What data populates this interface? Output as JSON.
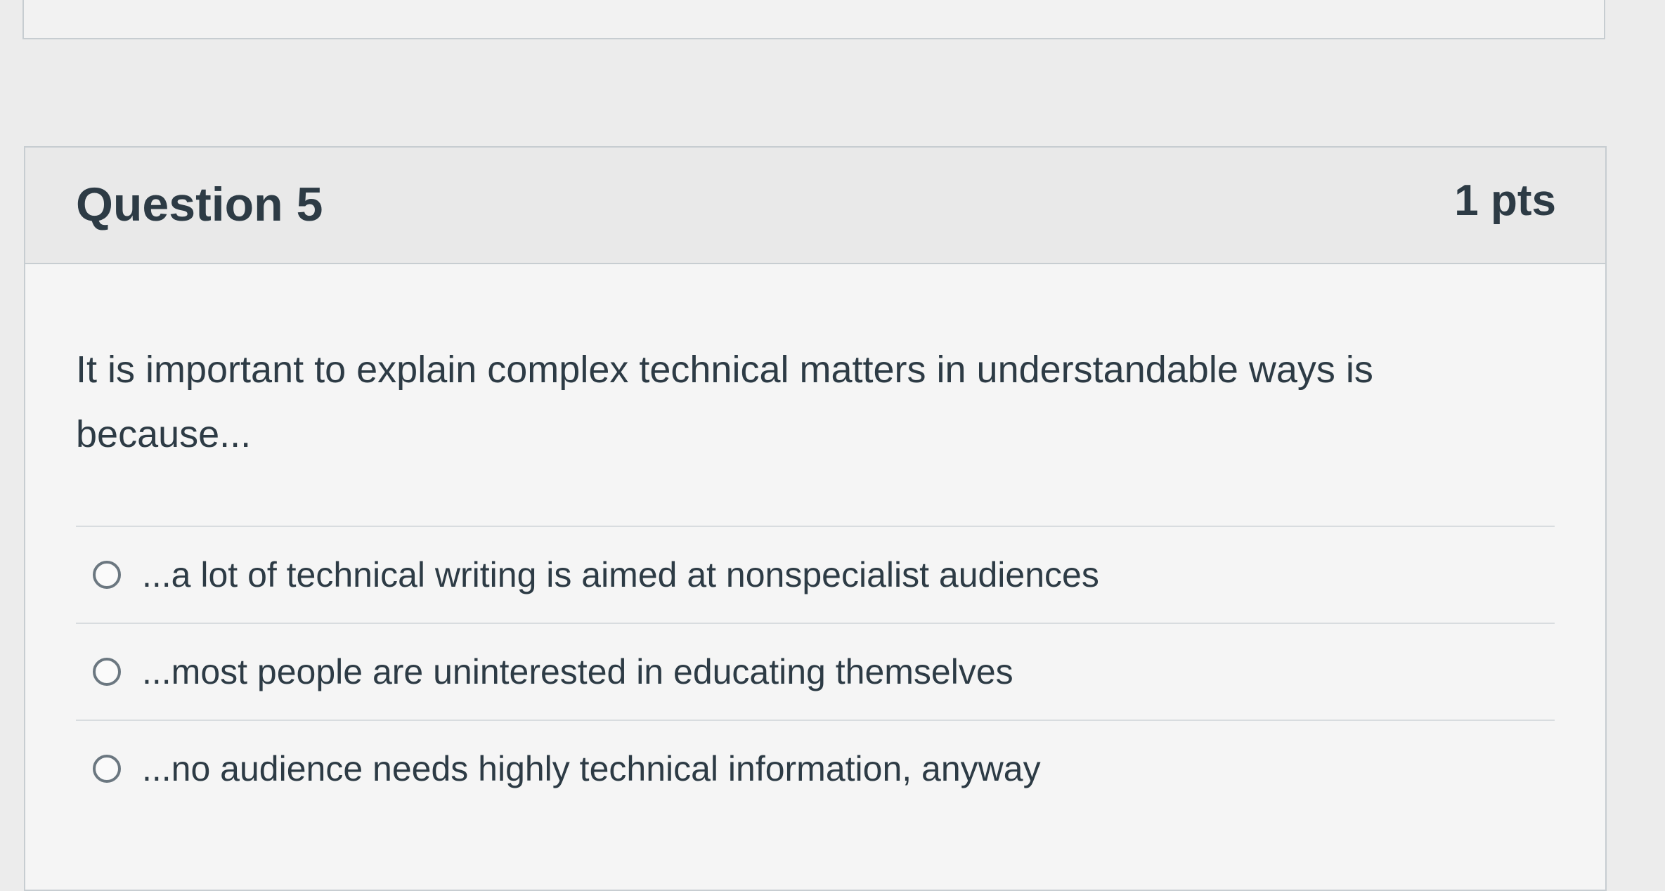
{
  "question": {
    "title": "Question 5",
    "points": "1 pts",
    "text": "It is important to explain complex technical matters in understandable ways is because...",
    "answers": [
      {
        "label": "...a lot of technical writing is aimed at nonspecialist audiences"
      },
      {
        "label": "...most people are uninterested in educating themselves"
      },
      {
        "label": "...no audience needs highly technical information, anyway"
      }
    ]
  }
}
